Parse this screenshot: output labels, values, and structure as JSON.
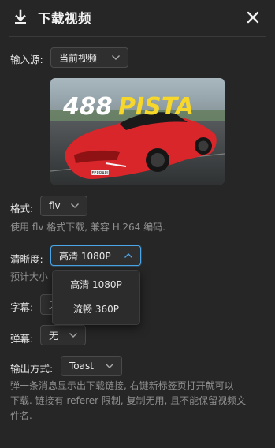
{
  "header": {
    "title": "下载视频",
    "download_icon": "download-icon",
    "close_icon": "close-icon"
  },
  "input_source": {
    "label": "输入源:",
    "value": "当前视频"
  },
  "thumbnail": {
    "overlay_text_white": "488",
    "overlay_text_yellow": "PISTA",
    "plate": "FERRARI"
  },
  "format": {
    "label": "格式:",
    "value": "flv",
    "hint": "使用 flv 格式下载, 兼容 H.264 编码."
  },
  "quality": {
    "label": "清晰度:",
    "value": "高清 1080P",
    "hint_partial": "预计大小",
    "options": [
      "高清 1080P",
      "流畅 360P"
    ]
  },
  "subtitle": {
    "label": "字幕:",
    "value_partial": "无"
  },
  "danmaku": {
    "label": "弹幕:",
    "value": "无"
  },
  "output": {
    "label": "输出方式:",
    "value": "Toast",
    "hint_line1": "弹一条消息显示出下载链接, 右键新标签页打开就可以",
    "hint_line2": "下载. 链接有 referer 限制, 复制无用, 且不能保留视频文",
    "hint_line3": "件名."
  },
  "colors": {
    "background": "#262626",
    "accent": "#4aa6e8",
    "title_yellow": "#f6d72a",
    "car_red": "#d8262b"
  }
}
